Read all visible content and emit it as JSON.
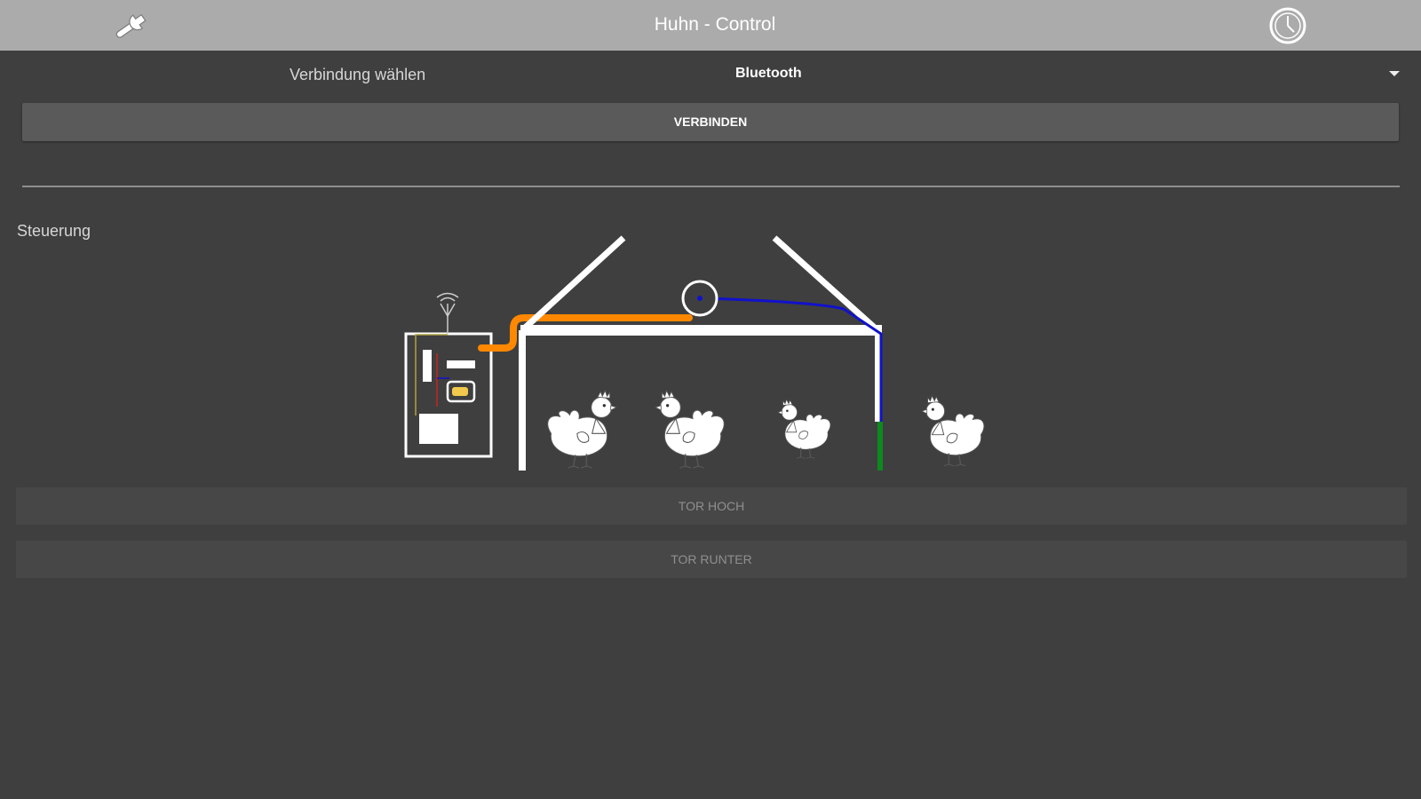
{
  "app": {
    "title": "Huhn - Control"
  },
  "toolbar": {
    "settings_icon": "wrench-icon",
    "history_icon": "clock-icon"
  },
  "connection": {
    "label": "Verbindung wählen",
    "selected": "Bluetooth",
    "connect_label": "VERBINDEN"
  },
  "control": {
    "section_label": "Steuerung",
    "door_up_label": "TOR HOCH",
    "door_down_label": "TOR RUNTER"
  },
  "colors": {
    "topbar": "#ababab",
    "background": "#3f3f3f",
    "cable_power": "#ff8800",
    "cable_signal": "#1111cc",
    "door_status": "#0b8a1f",
    "battery": "#f2c94c"
  }
}
